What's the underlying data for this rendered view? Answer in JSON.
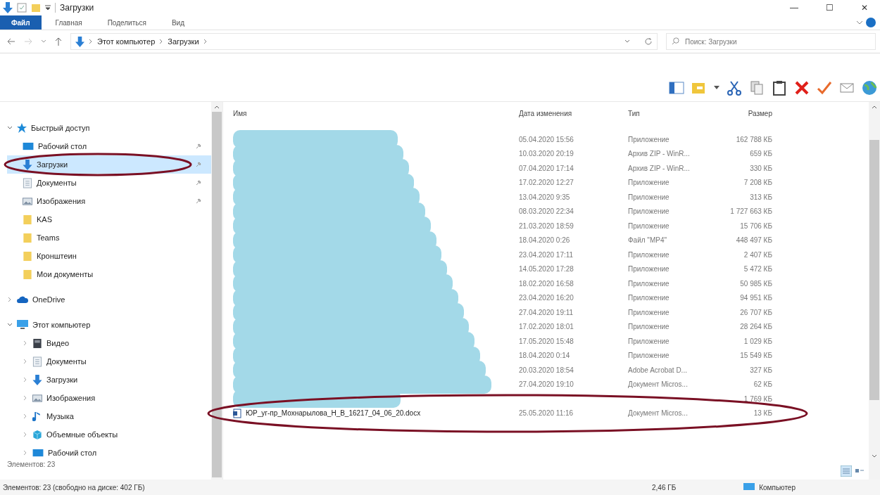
{
  "window": {
    "title": "Загрузки",
    "controls": [
      "—",
      "☐",
      "✕"
    ]
  },
  "ribbon": {
    "tabs": [
      {
        "label": "Файл",
        "selected": true
      },
      {
        "label": "Главная",
        "selected": false
      },
      {
        "label": "Поделиться",
        "selected": false
      },
      {
        "label": "Вид",
        "selected": false
      }
    ]
  },
  "address": {
    "crumbs": [
      "Этот компьютер",
      "Загрузки"
    ]
  },
  "search": {
    "placeholder": "Поиск: Загрузки"
  },
  "sidebar": {
    "sections": [
      {
        "label": "Быстрый доступ",
        "kind": "star",
        "expanded": true,
        "children": [
          {
            "label": "Рабочий стол",
            "kind": "desktop",
            "pinned": true,
            "selected": false,
            "circled": false
          },
          {
            "label": "Загрузки",
            "kind": "download",
            "pinned": true,
            "selected": true,
            "circled": true
          },
          {
            "label": "Документы",
            "kind": "docs",
            "pinned": true,
            "selected": false,
            "circled": false
          },
          {
            "label": "Изображения",
            "kind": "pictures",
            "pinned": true,
            "selected": false,
            "circled": false
          },
          {
            "label": "KAS",
            "kind": "folder",
            "pinned": false,
            "selected": false,
            "circled": false
          },
          {
            "label": "Teams",
            "kind": "folder",
            "pinned": false,
            "selected": false,
            "circled": false
          },
          {
            "label": "Кронштеин",
            "kind": "folder",
            "pinned": false,
            "selected": false,
            "circled": false
          },
          {
            "label": "Мои документы",
            "kind": "folder",
            "pinned": false,
            "selected": false,
            "circled": false
          }
        ]
      },
      {
        "label": "OneDrive",
        "kind": "cloud",
        "expanded": false
      },
      {
        "label": "Этот компьютер",
        "kind": "pc",
        "expanded": true,
        "children": [
          {
            "label": "Видео",
            "kind": "video",
            "pinned": false,
            "selected": false,
            "circled": false
          },
          {
            "label": "Документы",
            "kind": "docs",
            "pinned": false,
            "selected": false,
            "circled": false
          },
          {
            "label": "Загрузки",
            "kind": "download",
            "pinned": false,
            "selected": false,
            "circled": false
          },
          {
            "label": "Изображения",
            "kind": "pictures",
            "pinned": false,
            "selected": false,
            "circled": false
          },
          {
            "label": "Музыка",
            "kind": "music",
            "pinned": false,
            "selected": false,
            "circled": false
          },
          {
            "label": "Объемные объекты",
            "kind": "cube",
            "pinned": false,
            "selected": false,
            "circled": false
          },
          {
            "label": "Рабочий стол",
            "kind": "desktop",
            "pinned": false,
            "selected": false,
            "circled": false
          }
        ]
      }
    ],
    "footer": "Элементов: 23"
  },
  "table": {
    "columns": [
      "Имя",
      "Дата изменения",
      "Тип",
      "Размер"
    ],
    "rows": [
      {
        "date": "05.04.2020 15:56",
        "type": "Приложение",
        "size": "162 788 КБ",
        "redacted": true,
        "circled": false
      },
      {
        "date": "10.03.2020 20:19",
        "type": "Архив ZIP - WinR...",
        "size": "659 КБ",
        "redacted": true,
        "circled": false
      },
      {
        "date": "07.04.2020 17:14",
        "type": "Архив ZIP - WinR...",
        "size": "330 КБ",
        "redacted": true,
        "circled": false
      },
      {
        "date": "17.02.2020 12:27",
        "type": "Приложение",
        "size": "7 208 КБ",
        "redacted": true,
        "circled": false
      },
      {
        "date": "13.04.2020 9:35",
        "type": "Приложение",
        "size": "313 КБ",
        "redacted": true,
        "circled": false
      },
      {
        "date": "08.03.2020 22:34",
        "type": "Приложение",
        "size": "1 727 663 КБ",
        "redacted": true,
        "circled": false
      },
      {
        "date": "21.03.2020 18:59",
        "type": "Приложение",
        "size": "15 706 КБ",
        "redacted": true,
        "circled": false
      },
      {
        "date": "18.04.2020 0:26",
        "type": "Файл \"MP4\"",
        "size": "448 497 КБ",
        "redacted": true,
        "circled": false
      },
      {
        "date": "23.04.2020 17:11",
        "type": "Приложение",
        "size": "2 407 КБ",
        "redacted": true,
        "circled": false
      },
      {
        "date": "14.05.2020 17:28",
        "type": "Приложение",
        "size": "5 472 КБ",
        "redacted": true,
        "circled": false
      },
      {
        "date": "18.02.2020 16:58",
        "type": "Приложение",
        "size": "50 985 КБ",
        "redacted": true,
        "circled": false
      },
      {
        "date": "23.04.2020 16:20",
        "type": "Приложение",
        "size": "94 951 КБ",
        "redacted": true,
        "circled": false
      },
      {
        "date": "27.04.2020 19:11",
        "type": "Приложение",
        "size": "26 707 КБ",
        "redacted": true,
        "circled": false
      },
      {
        "date": "17.02.2020 18:01",
        "type": "Приложение",
        "size": "28 264 КБ",
        "redacted": true,
        "circled": false
      },
      {
        "date": "17.05.2020 15:48",
        "type": "Приложение",
        "size": "1 029 КБ",
        "redacted": true,
        "circled": false
      },
      {
        "date": "18.04.2020 0:14",
        "type": "Приложение",
        "size": "15 549 КБ",
        "redacted": true,
        "circled": false
      },
      {
        "date": "20.03.2020 18:54",
        "type": "Adobe Acrobat D...",
        "size": "327 КБ",
        "redacted": true,
        "circled": false
      },
      {
        "date": "27.04.2020 19:10",
        "type": "Документ Micros...",
        "size": "62 КБ",
        "redacted": true,
        "circled": false
      },
      {
        "size": "1 769 КБ",
        "redacted": true,
        "circled": false
      },
      {
        "name": "ЮР_уг-пр_Мохнарылова_Н_В_16217_04_06_20.docx",
        "date": "25.05.2020 11:16",
        "type": "Документ Micros...",
        "size": "13 КБ",
        "redacted": false,
        "circled": true
      }
    ]
  },
  "status_bar": {
    "items": "Элементов: 23 (свободно на диске: 402 ГБ)",
    "total": "2,46 ГБ",
    "zone": "Компьютер"
  }
}
